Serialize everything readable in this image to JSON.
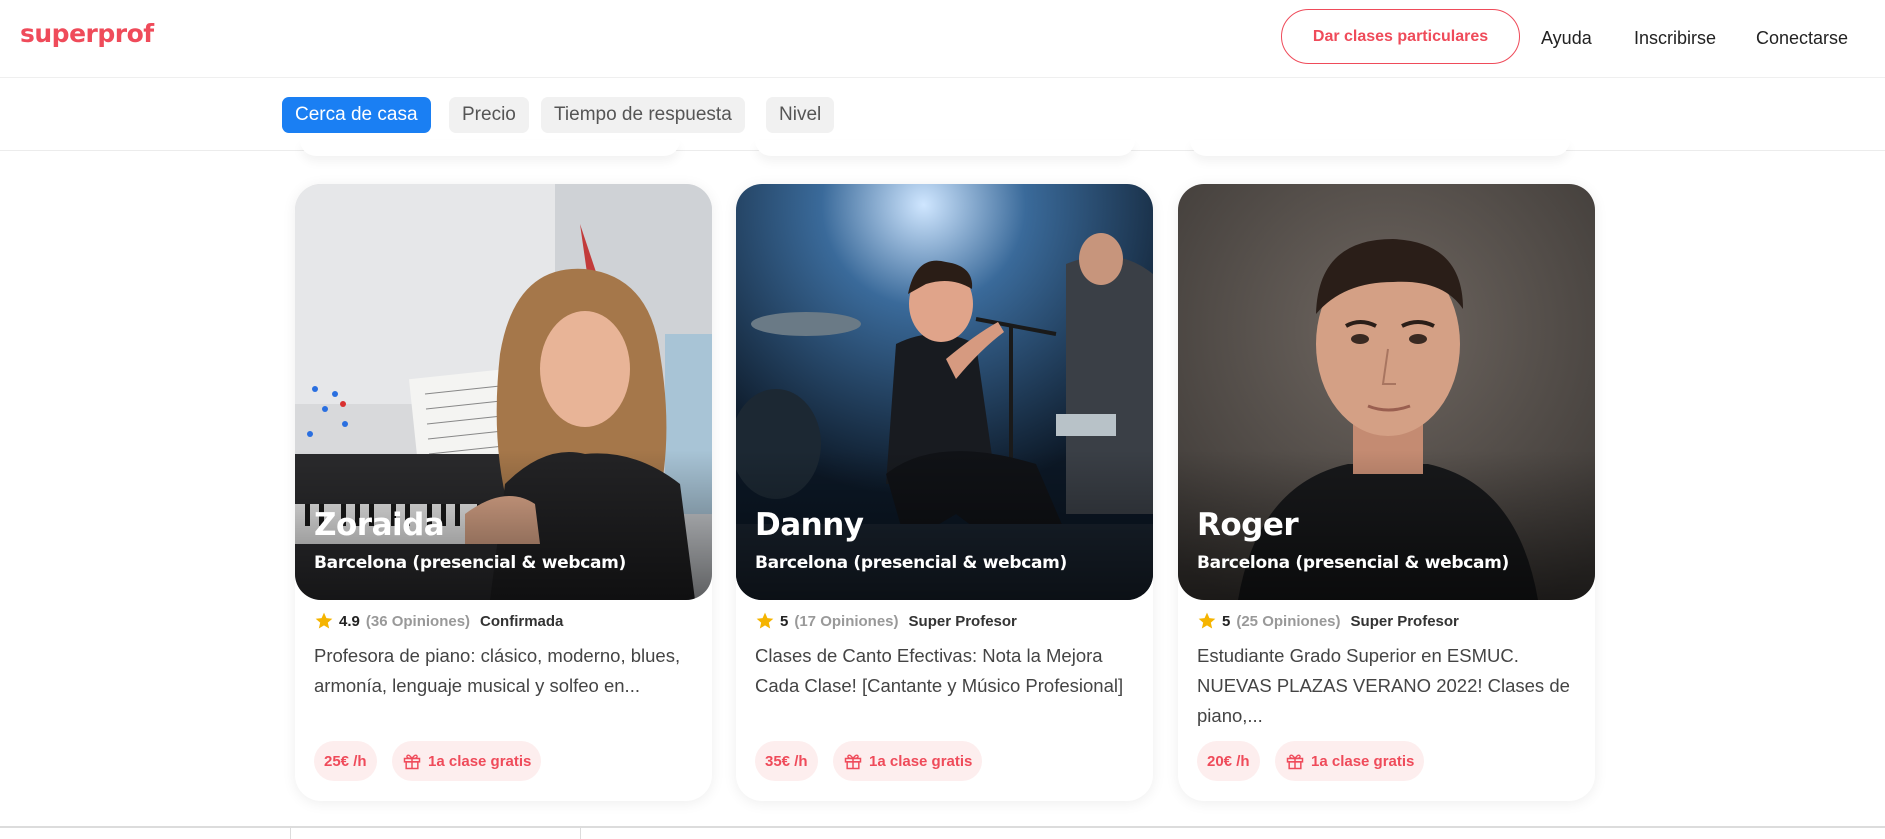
{
  "header": {
    "logo": "superprof",
    "teach_button": "Dar clases particulares",
    "nav": [
      "Ayuda",
      "Inscribirse",
      "Conectarse"
    ]
  },
  "filters": [
    {
      "label": "Cerca de casa",
      "active": true
    },
    {
      "label": "Precio",
      "active": false
    },
    {
      "label": "Tiempo de respuesta",
      "active": false
    },
    {
      "label": "Nivel",
      "active": false
    }
  ],
  "cards": [
    {
      "name": "Zoraida",
      "location": "Barcelona (presencial & webcam)",
      "rating": "4.9",
      "reviews": "(36 Opiniones)",
      "badge": "Confirmada",
      "description": "Profesora de piano: clásico, moderno, blues, armonía, lenguaje musical y solfeo en...",
      "price": "25€ /h",
      "free_class": "1a clase gratis"
    },
    {
      "name": "Danny",
      "location": "Barcelona (presencial & webcam)",
      "rating": "5",
      "reviews": "(17 Opiniones)",
      "badge": "Super Profesor",
      "description": "Clases de Canto Efectivas: Nota la Mejora Cada Clase! [Cantante y Músico Profesional]",
      "price": "35€ /h",
      "free_class": "1a clase gratis"
    },
    {
      "name": "Roger",
      "location": "Barcelona (presencial & webcam)",
      "rating": "5",
      "reviews": "(25 Opiniones)",
      "badge": "Super Profesor",
      "description": "Estudiante Grado Superior en ESMUC. NUEVAS PLAZAS VERANO 2022! Clases de piano,...",
      "price": "20€ /h",
      "free_class": "1a clase gratis"
    }
  ],
  "colors": {
    "brand": "#ef4b5a",
    "active_chip": "#1a7ff3",
    "star": "#f5b400",
    "pill_bg": "#fdeeee"
  },
  "icons": [
    "star-icon",
    "gift-icon"
  ]
}
